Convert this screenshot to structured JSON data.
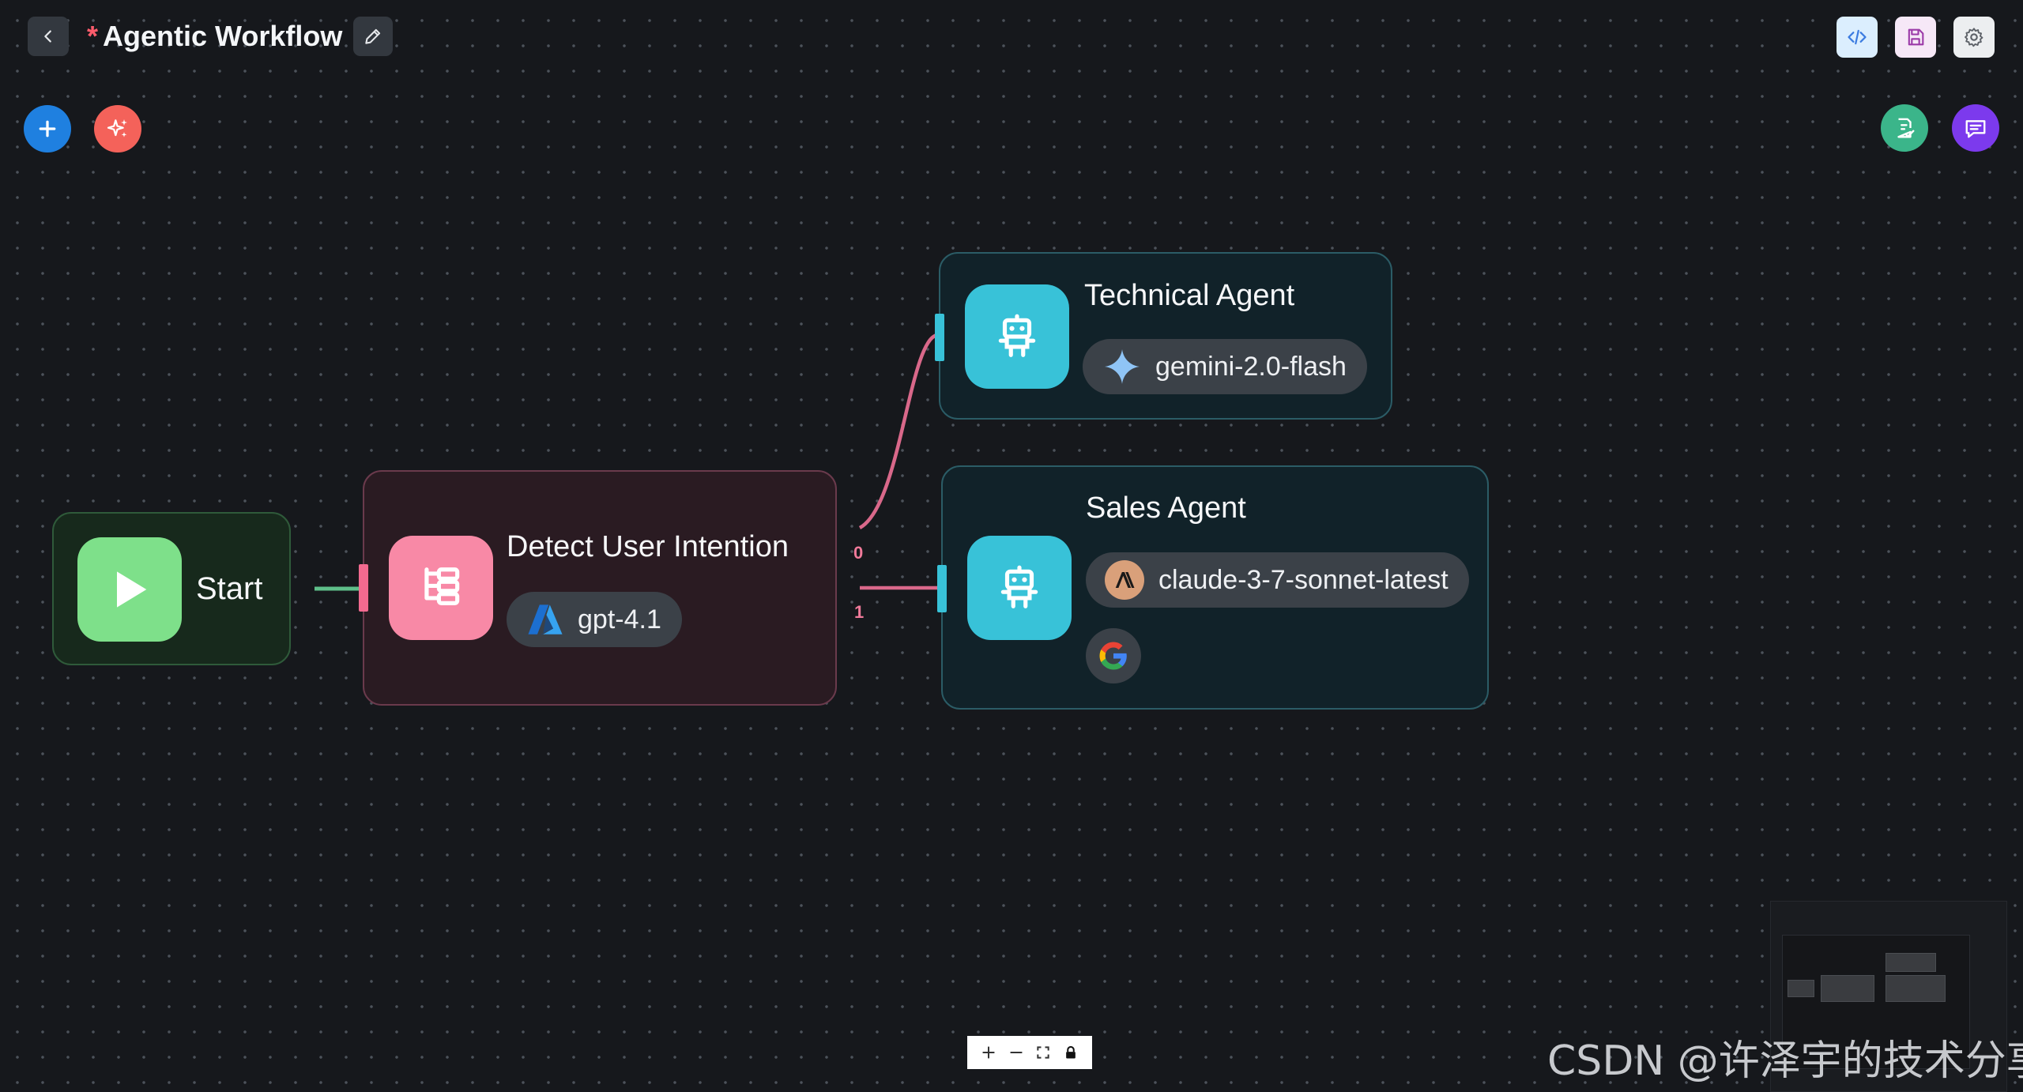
{
  "header": {
    "unsaved_marker": "*",
    "title": "Agentic Workflow"
  },
  "icons": {
    "back": "chevron-left-icon",
    "edit": "pencil-icon",
    "code": "code-icon",
    "save": "floppy-disk-icon",
    "settings": "gear-icon",
    "add": "plus-icon",
    "ai_generate": "sparkles-icon",
    "checklist": "clipboard-check-icon",
    "chat": "chat-bubble-icon"
  },
  "nodes": {
    "start": {
      "label": "Start"
    },
    "detect": {
      "label": "Detect User Intention",
      "model": "gpt-4.1"
    },
    "technical": {
      "label": "Technical Agent",
      "model": "gemini-2.0-flash"
    },
    "sales": {
      "label": "Sales Agent",
      "model": "claude-3-7-sonnet-latest",
      "tool": "google-icon"
    }
  },
  "ports": {
    "out0": "0",
    "out1": "1"
  },
  "zoom_controls": [
    "zoom-in",
    "zoom-out",
    "fit-view",
    "lock"
  ],
  "watermark": "CSDN @许泽宇的技术分享",
  "colors": {
    "background": "#16181c",
    "start_accent": "#7ee08a",
    "condition_accent": "#f889a6",
    "agent_accent": "#38c2d8",
    "add_button": "#1f80e0",
    "ai_button": "#f4625a",
    "checklist_button": "#3bb58a",
    "chat_button": "#7c3aed"
  }
}
